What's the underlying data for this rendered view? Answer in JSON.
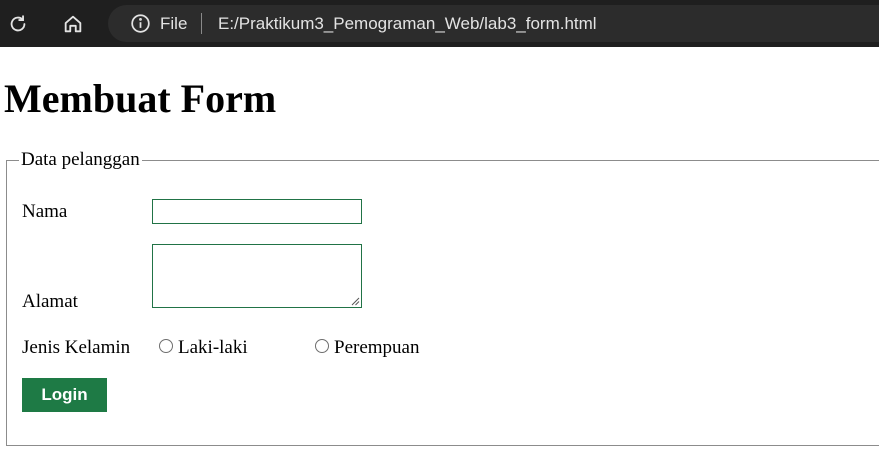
{
  "browser": {
    "file_label": "File",
    "url": "E:/Praktikum3_Pemograman_Web/lab3_form.html"
  },
  "page": {
    "title": "Membuat Form"
  },
  "form": {
    "legend": "Data pelanggan",
    "nama_label": "Nama",
    "nama_value": "",
    "alamat_label": "Alamat",
    "alamat_value": "",
    "jenis_kelamin_label": "Jenis Kelamin",
    "options": [
      "Laki-laki",
      "Perempuan"
    ],
    "selected_option": null,
    "submit_label": "Login"
  },
  "colors": {
    "browser_bar": "#1f1f1f",
    "address_bar": "#2c2c2c",
    "accent_green": "#1e7a45",
    "input_border": "#217346"
  },
  "icons": [
    "reload-icon",
    "home-icon",
    "info-icon",
    "resize-grip-icon"
  ]
}
